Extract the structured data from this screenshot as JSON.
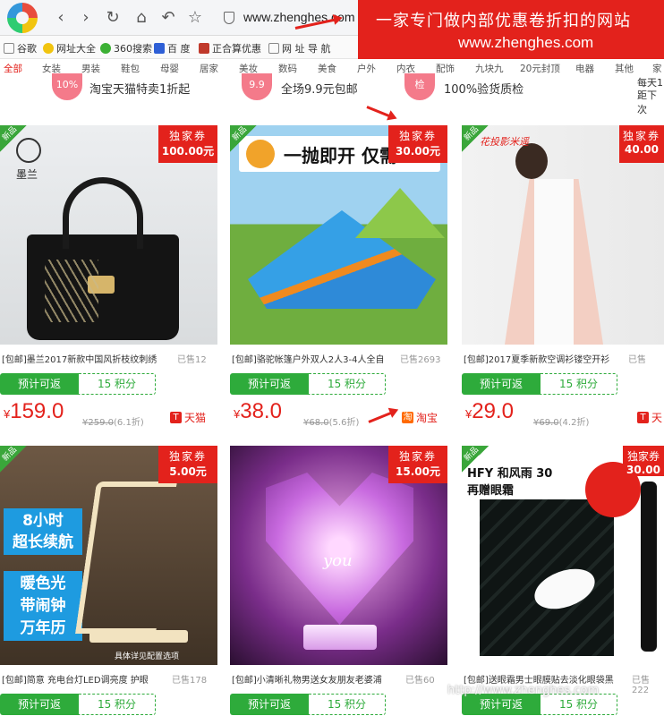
{
  "browser": {
    "url": "www.zhenghes.com",
    "banner_line1": "一家专门做内部优惠卷折扣的网站",
    "banner_line2": "www.zhenghes.com"
  },
  "bookmarks": [
    "谷歌",
    "网址大全",
    "360搜索",
    "百 度",
    "正合算优惠",
    "网 址 导 航"
  ],
  "categories": [
    "全部",
    "女装",
    "男装",
    "鞋包",
    "母婴",
    "居家",
    "美妆",
    "数码",
    "美食",
    "户外",
    "内衣",
    "配饰",
    "九块九",
    "20元封顶",
    "电器",
    "其他",
    "家"
  ],
  "features": [
    {
      "badge": "10%",
      "text": "淘宝天猫特卖1折起"
    },
    {
      "badge": "9.9",
      "text": "全场9.9元包邮"
    },
    {
      "badge": "检",
      "text": "100%验货质检"
    }
  ],
  "features_right": [
    "每天1",
    "距下次"
  ],
  "card_labels": {
    "new": "新品",
    "coupon": "独家券",
    "rebate": "预计可返",
    "currency": "¥"
  },
  "products": [
    {
      "title": "[包邮]墨兰2017新款中国风折枝纹刺绣",
      "sold": "已售12",
      "coupon": "100.00元",
      "points": "15 积分",
      "price": "159.0",
      "oprice": "259.0",
      "disc": "(6.1折)",
      "shop": "天猫",
      "shop_icon": "T",
      "image_text": "墨兰"
    },
    {
      "title": "[包邮]骆驼帐篷户外双人2人3-4人全自",
      "sold": "已售2693",
      "coupon": "30.00元",
      "points": "15 积分",
      "price": "38.0",
      "oprice": "68.0",
      "disc": "(5.6折)",
      "shop": "淘宝",
      "shop_icon": "淘",
      "image_text": "一抛即开 仅需1"
    },
    {
      "title": "[包邮]2017夏季新款空调衫镂空开衫",
      "sold": "已售",
      "coupon": "40.00",
      "points": "15 积分",
      "price": "29.0",
      "oprice": "69.0",
      "disc": "(4.2折)",
      "shop": "天",
      "shop_icon": "T",
      "image_text": "花投影米遥"
    },
    {
      "title": "[包邮]简意 充电台灯LED调亮度 护眼",
      "sold": "已售178",
      "coupon": "5.00元",
      "points": "15 积分",
      "price": "",
      "oprice": "",
      "disc": "",
      "shop": "",
      "shop_icon": "",
      "image_text": "8小时 超长续航 暖色光 带闹钟 万年历 具体详见配置选项"
    },
    {
      "title": "[包邮]小清晰礼物男送女友朋友老婆浦",
      "sold": "已售60",
      "coupon": "15.00元",
      "points": "15 积分",
      "price": "",
      "oprice": "",
      "disc": "",
      "shop": "",
      "shop_icon": "",
      "image_text": "you"
    },
    {
      "title": "[包邮]送眼霜男士眼膜贴去淡化眼袋黑",
      "sold": "已售222",
      "coupon": "30.00",
      "points": "15 积分",
      "price": "",
      "oprice": "",
      "disc": "",
      "shop": "",
      "shop_icon": "",
      "image_text": "HFY 和风雨 30 再赠眼霜"
    }
  ],
  "watermark": "http://www.zhenghes.com",
  "colors": {
    "accent": "#e3221c",
    "green": "#2eab3b"
  }
}
